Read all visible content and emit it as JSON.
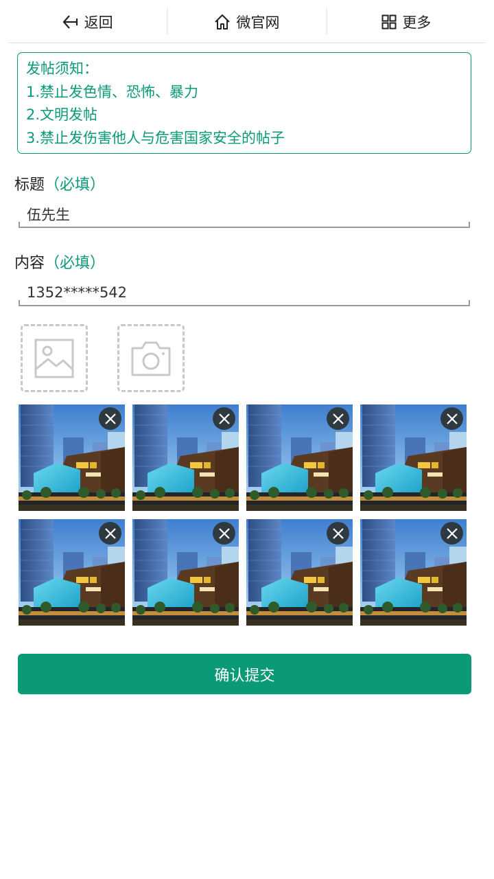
{
  "nav": {
    "back_label": "返回",
    "home_label": "微官网",
    "more_label": "更多"
  },
  "notice": {
    "lines": [
      "发帖须知：",
      "1.禁止发色情、恐怖、暴力",
      "2.文明发帖",
      "3.禁止发伤害他人与危害国家安全的帖子"
    ]
  },
  "form": {
    "title_label": "标题",
    "title_required": "（必填）",
    "title_value": "伍先生",
    "content_label": "内容",
    "content_required": "（必填）",
    "content_value": "1352*****542"
  },
  "uploads": {
    "icons": [
      "image-icon",
      "camera-icon"
    ]
  },
  "photos": {
    "count": 8,
    "delete_icon": "close-icon"
  },
  "submit_label": "确认提交",
  "colors": {
    "accent": "#0a9a78",
    "delete_button": "#2f3a40",
    "dashed_border": "#c8c8c8"
  }
}
